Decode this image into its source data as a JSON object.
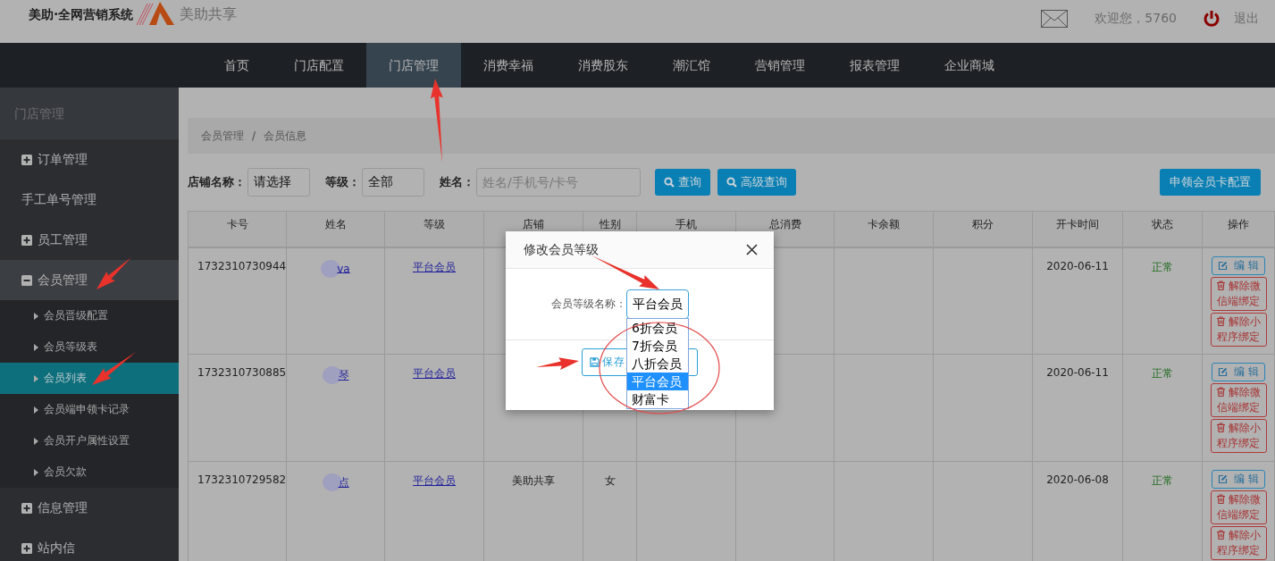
{
  "header": {
    "brand": "美助·全网营销系统",
    "logo_text": "美助共享",
    "welcome": "欢迎您，5760",
    "logout": "退出"
  },
  "nav": [
    {
      "label": "首页",
      "selected": false
    },
    {
      "label": "门店配置",
      "selected": false
    },
    {
      "label": "门店管理",
      "selected": true
    },
    {
      "label": "消费幸福",
      "selected": false
    },
    {
      "label": "消费股东",
      "selected": false
    },
    {
      "label": "潮汇馆",
      "selected": false
    },
    {
      "label": "营销管理",
      "selected": false
    },
    {
      "label": "报表管理",
      "selected": false
    },
    {
      "label": "企业商城",
      "selected": false
    }
  ],
  "sidebar": {
    "title": "门店管理",
    "items": [
      {
        "kind": "group",
        "label": "订单管理",
        "expanded": false
      },
      {
        "kind": "link",
        "label": "手工单号管理"
      },
      {
        "kind": "group",
        "label": "员工管理",
        "expanded": false
      },
      {
        "kind": "group",
        "label": "会员管理",
        "expanded": true,
        "children": [
          {
            "label": "会员晋级配置",
            "selected": false
          },
          {
            "label": "会员等级表",
            "selected": false
          },
          {
            "label": "会员列表",
            "selected": true
          },
          {
            "label": "会员端申领卡记录",
            "selected": false
          },
          {
            "label": "会员开户属性设置",
            "selected": false
          },
          {
            "label": "会员欠款",
            "selected": false
          }
        ]
      },
      {
        "kind": "group",
        "label": "信息管理",
        "expanded": false
      },
      {
        "kind": "group",
        "label": "站内信",
        "expanded": false
      }
    ]
  },
  "breadcrumb": {
    "items": [
      "会员管理",
      "会员信息"
    ],
    "separator": "/"
  },
  "filters": {
    "store": {
      "label": "店铺名称：",
      "value": "请选择"
    },
    "level": {
      "label": "等级：",
      "value": "全部"
    },
    "name": {
      "label": "姓名：",
      "placeholder": "姓名/手机号/卡号"
    },
    "buttons": [
      "查询",
      "高级查询"
    ],
    "config_button": "申领会员卡配置"
  },
  "table": {
    "columns": [
      "卡号",
      "姓名",
      "等级",
      "店铺",
      "性别",
      "手机",
      "总消费",
      "卡余额",
      "积分",
      "开卡时间",
      "状态",
      "操作"
    ],
    "rows": [
      {
        "card": "1732310730944",
        "name": "va",
        "level": "平台会员",
        "opened": "2020-06-11",
        "status": "正常",
        "actions": [
          {
            "kind": "edit",
            "label": "编辑"
          },
          {
            "kind": "unbind",
            "label": "解除微信端绑定"
          },
          {
            "kind": "unbind",
            "label": "解除小程序绑定"
          }
        ]
      },
      {
        "card": "1732310730885",
        "name": "琴",
        "level": "平台会员",
        "opened": "2020-06-11",
        "status": "正常",
        "actions": [
          {
            "kind": "edit",
            "label": "编辑"
          },
          {
            "kind": "unbind",
            "label": "解除微信端绑定"
          },
          {
            "kind": "unbind",
            "label": "解除小程序绑定"
          }
        ]
      },
      {
        "card": "1732310729582",
        "name": "点",
        "level": "平台会员",
        "store": "美助共享",
        "gender": "女",
        "opened": "2020-06-08",
        "status": "正常",
        "actions": [
          {
            "kind": "edit",
            "label": "编辑"
          },
          {
            "kind": "unbind",
            "label": "解除微信端绑定"
          },
          {
            "kind": "unbind",
            "label": "解除小程序绑定"
          }
        ]
      }
    ]
  },
  "modal": {
    "title": "修改会员等级",
    "field_label": "会员等级名称：",
    "value": "平台会员",
    "save": "保存",
    "options": [
      {
        "label": "6折会员",
        "selected": false
      },
      {
        "label": "7折会员",
        "selected": false
      },
      {
        "label": "八折会员",
        "selected": false
      },
      {
        "label": "平台会员",
        "selected": true
      },
      {
        "label": "财富卡",
        "selected": false
      }
    ]
  }
}
